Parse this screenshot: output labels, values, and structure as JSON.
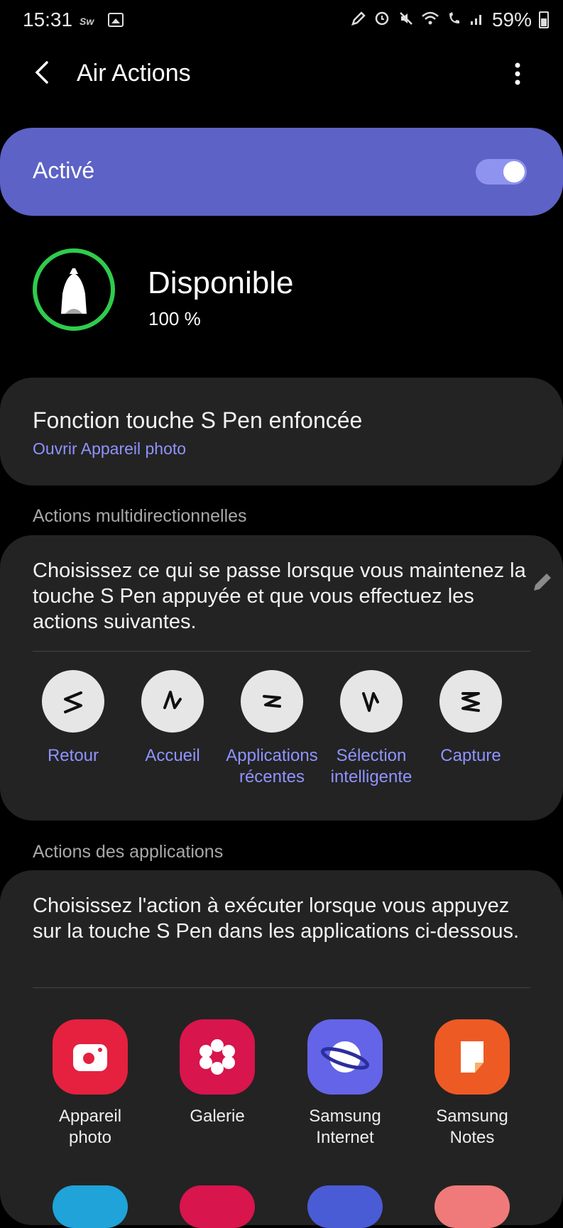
{
  "status_bar": {
    "time": "15:31",
    "carrier": "Sw",
    "battery": "59%",
    "icons": [
      "pen-icon",
      "alarm-icon",
      "mute-icon",
      "wifi-icon",
      "wifi-call-icon",
      "signal-icon",
      "battery-icon"
    ]
  },
  "header": {
    "title": "Air Actions"
  },
  "main_toggle": {
    "label": "Activé",
    "on": true
  },
  "pen": {
    "status": "Disponible",
    "battery": "100 %"
  },
  "button_function": {
    "title": "Fonction touche S Pen enfoncée",
    "value": "Ouvrir Appareil photo"
  },
  "gestures_section": {
    "label": "Actions multidirectionnelles",
    "description": "Choisissez ce qui se passe lorsque vous maintenez la touche S Pen appuyée et que vous effectuez les actions suivantes.",
    "items": [
      {
        "label": "Retour"
      },
      {
        "label": "Accueil"
      },
      {
        "label": "Applications récentes"
      },
      {
        "label": "Sélection intelligente"
      },
      {
        "label": "Capture"
      }
    ]
  },
  "apps_section": {
    "label": "Actions des applications",
    "description": "Choisissez l'action à exécuter lorsque vous appuyez sur la touche S Pen dans les applications ci-dessous.",
    "apps": [
      {
        "label": "Appareil photo",
        "icon": "camera-icon",
        "color": "#e5213f"
      },
      {
        "label": "Galerie",
        "icon": "flower-icon",
        "color": "#d8154c"
      },
      {
        "label": "Samsung Internet",
        "icon": "planet-icon",
        "color": "#6464e8"
      },
      {
        "label": "Samsung Notes",
        "icon": "notes-icon",
        "color": "#ee5a24"
      }
    ]
  },
  "colors": {
    "accent": "#5d62c7",
    "link": "#8f93ff",
    "ring": "#2fcc4d",
    "card": "#232323"
  }
}
